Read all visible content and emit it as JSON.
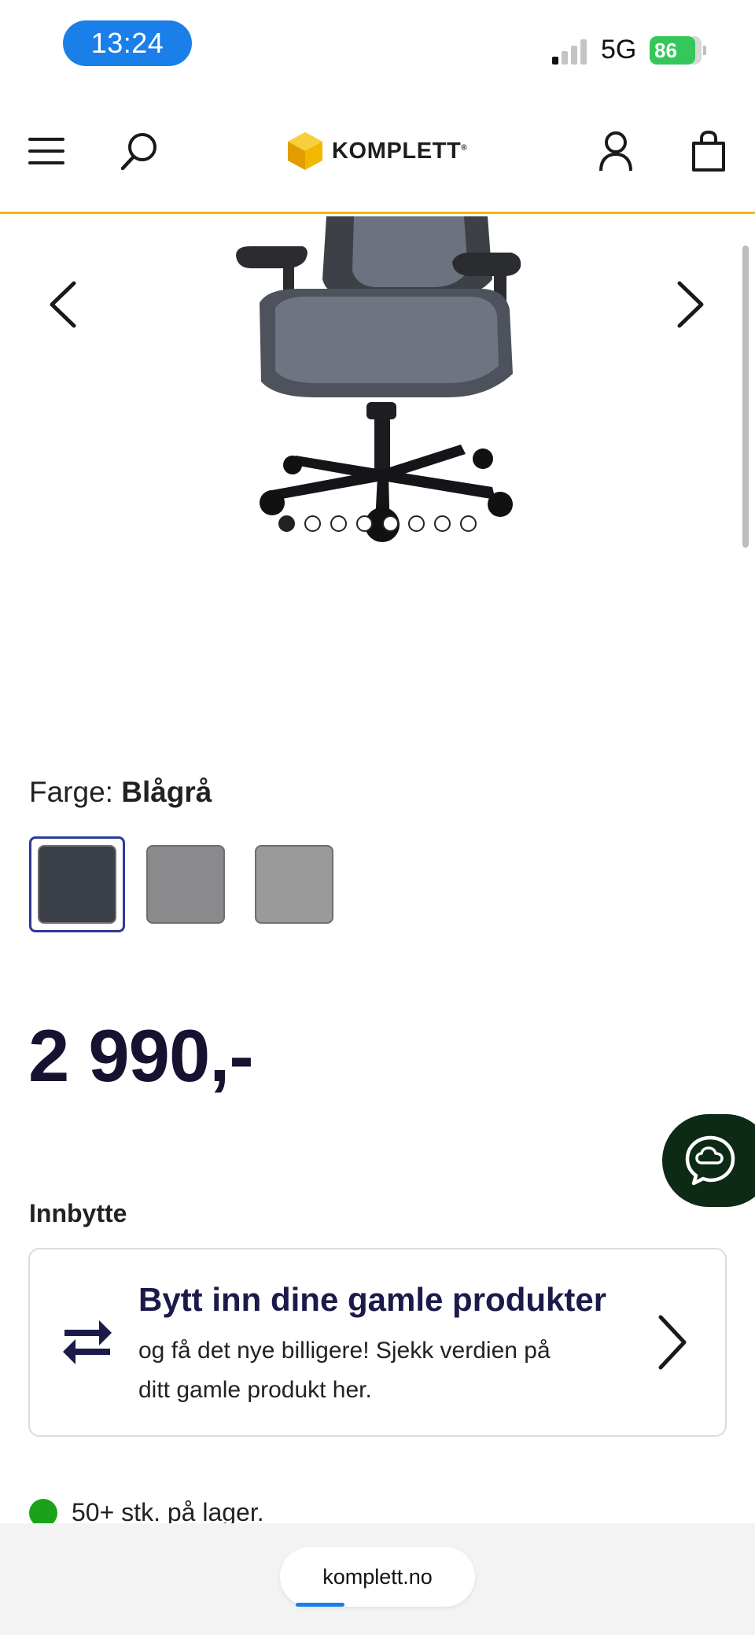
{
  "status_bar": {
    "time": "13:24",
    "network": "5G",
    "battery_level": "86",
    "signal_bars_active": 1,
    "signal_bars_total": 4
  },
  "header": {
    "logo_text": "KOMPLETT",
    "logo_mark": "®",
    "accent_color": "#f2b800"
  },
  "carousel": {
    "image_count": 8,
    "active_index": 0
  },
  "product": {
    "color_label": "Farge:",
    "color_value": "Blågrå",
    "swatches": [
      {
        "color": "#3b3f48",
        "selected": true
      },
      {
        "color": "#8a8a8c",
        "selected": false
      },
      {
        "color": "#9a9a9a",
        "selected": false
      }
    ],
    "price": "2 990,-"
  },
  "trade_in": {
    "section_title": "Innbytte",
    "heading": "Bytt inn dine gamle produkter",
    "body": "og få det nye billigere! Sjekk verdien på ditt gamle produkt her."
  },
  "stock": {
    "text": "50+ stk. på lager.",
    "status_color": "#1aa31a"
  },
  "browser": {
    "url": "komplett.no",
    "load_progress": 0.3
  }
}
